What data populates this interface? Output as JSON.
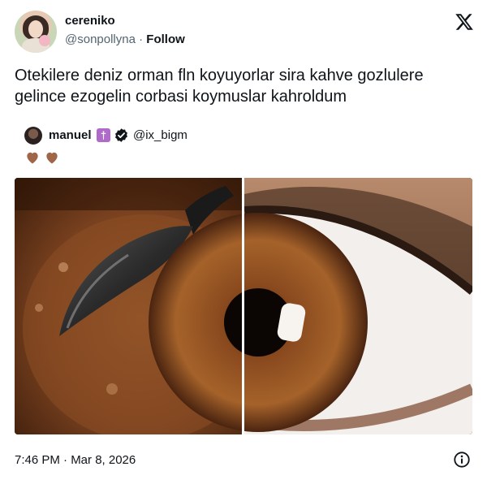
{
  "author": {
    "display_name": "cereniko",
    "handle": "@sonpollyna",
    "separator": "·",
    "follow_label": "Follow"
  },
  "tweet": {
    "text": "Otekilere deniz orman fln koyuyorlar sira kahve gozlulere gelince ezogelin corbasi koymuslar kahroldum"
  },
  "quoted": {
    "display_name": "manuel",
    "badge_glyph": "†",
    "handle": "@ix_bigm",
    "hearts": [
      "brown-heart-icon",
      "brown-heart-icon"
    ]
  },
  "media": {
    "left_image": "soup-with-spoon",
    "right_image": "brown-eye-closeup"
  },
  "footer": {
    "timestamp": "7:46 PM · Mar 8, 2026"
  },
  "icons": {
    "platform": "x-logo-icon",
    "verified": "verified-check-icon",
    "info": "info-icon"
  },
  "colors": {
    "text": "#0f1419",
    "secondary": "#536471",
    "heart": "#a0664a",
    "badge": "#b06ac9"
  }
}
